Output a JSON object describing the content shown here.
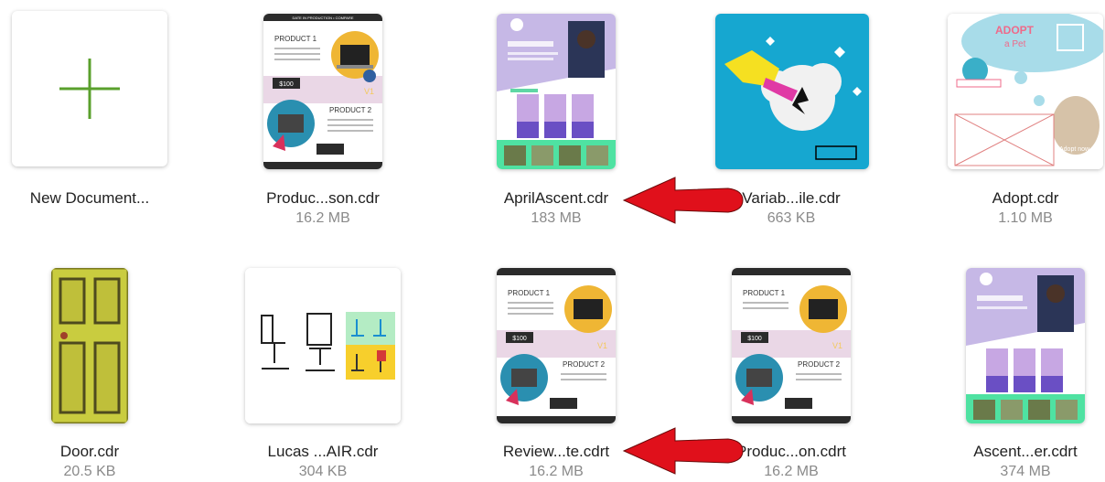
{
  "files": [
    {
      "name": "New Document...",
      "size": ""
    },
    {
      "name": "Produc...son.cdr",
      "size": "16.2 MB",
      "thumb_text": {
        "header": "DATE IN PRODUCTION • COMPARE",
        "p1": "PRODUCT 1",
        "p2": "PRODUCT 2",
        "price": "$100",
        "vs": "V1"
      }
    },
    {
      "name": "AprilAscent.cdr",
      "size": "183 MB"
    },
    {
      "name": "Variab...ile.cdr",
      "size": "663 KB"
    },
    {
      "name": "Adopt.cdr",
      "size": "1.10 MB",
      "thumb_text": {
        "title1": "ADOPT",
        "title2": "a Pet",
        "btn": "Adopt now"
      }
    },
    {
      "name": "Door.cdr",
      "size": "20.5 KB"
    },
    {
      "name": "Lucas ...AIR.cdr",
      "size": "304 KB"
    },
    {
      "name": "Review...te.cdrt",
      "size": "16.2 MB",
      "thumb_text": {
        "p1": "PRODUCT 1",
        "p2": "PRODUCT 2",
        "price": "$100",
        "vs": "V1"
      }
    },
    {
      "name": "Produc...on.cdrt",
      "size": "16.2 MB",
      "thumb_text": {
        "p1": "PRODUCT 1",
        "p2": "PRODUCT 2",
        "price": "$100",
        "vs": "V1"
      }
    },
    {
      "name": "Ascent...er.cdrt",
      "size": "374 MB"
    }
  ],
  "colors": {
    "arrow": "#e0101b",
    "plus": "#5aa02c"
  },
  "icons": [
    "plus-icon",
    "arrow-left-icon"
  ]
}
